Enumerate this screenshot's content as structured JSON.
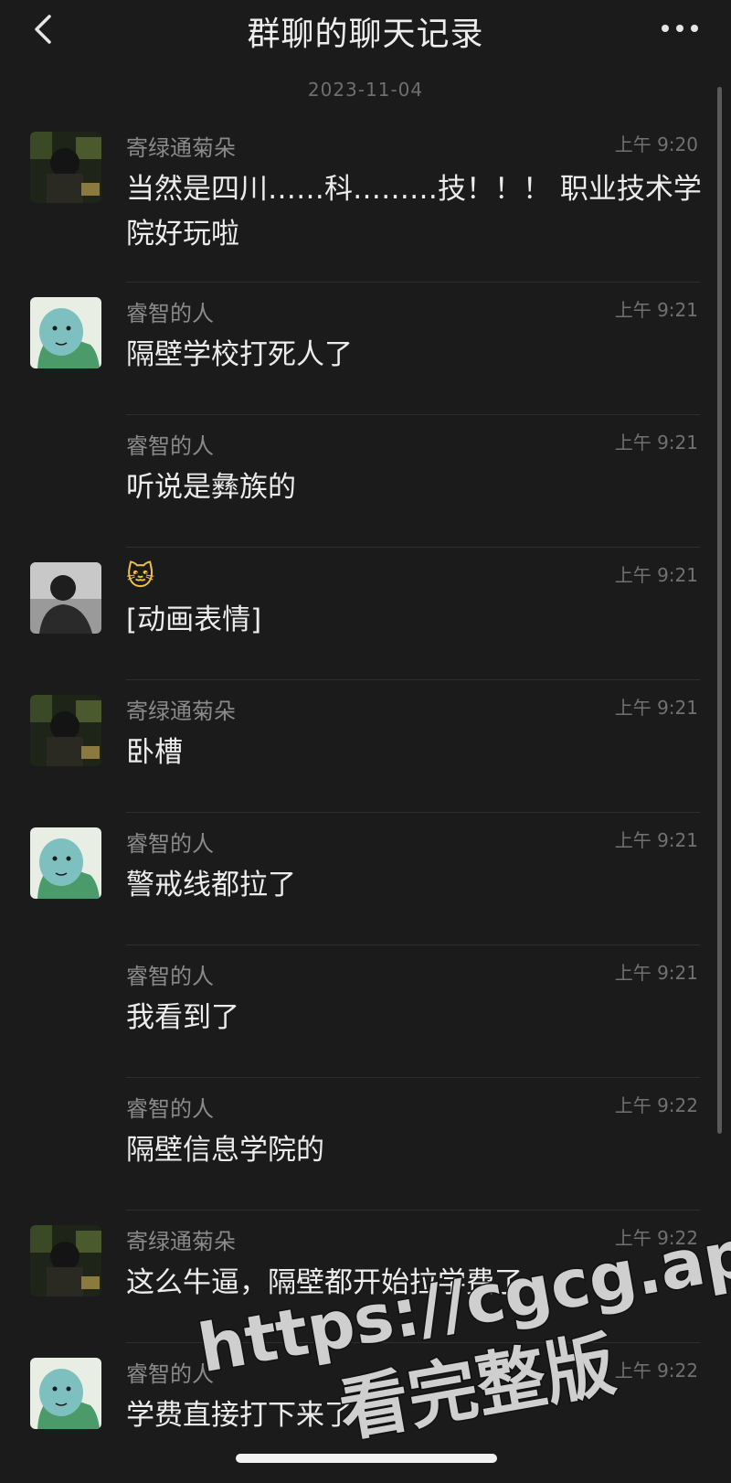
{
  "navbar": {
    "title": "群聊的聊天记录"
  },
  "date_separator": "2023-11-04",
  "messages": [
    {
      "sender": "寄绿通菊朵",
      "time": "上午 9:20",
      "text": "当然是四川……科………技！！！ 职业技术学院好玩啦",
      "avatar": "dark-photo"
    },
    {
      "sender": "睿智的人",
      "time": "上午 9:21",
      "text": "隔壁学校打死人了",
      "avatar": "turtle"
    },
    {
      "sender": "睿智的人",
      "time": "上午 9:21",
      "text": "听说是彝族的",
      "avatar": "none"
    },
    {
      "sender": "",
      "time": "上午 9:21",
      "text": "[动画表情]",
      "avatar": "person",
      "name_icon": "cat-emoji"
    },
    {
      "sender": "寄绿通菊朵",
      "time": "上午 9:21",
      "text": "卧槽",
      "avatar": "dark-photo"
    },
    {
      "sender": "睿智的人",
      "time": "上午 9:21",
      "text": "警戒线都拉了",
      "avatar": "turtle"
    },
    {
      "sender": "睿智的人",
      "time": "上午 9:21",
      "text": "我看到了",
      "avatar": "none"
    },
    {
      "sender": "睿智的人",
      "time": "上午 9:22",
      "text": "隔壁信息学院的",
      "avatar": "none"
    },
    {
      "sender": "寄绿通菊朵",
      "time": "上午 9:22",
      "text": "这么牛逼，隔壁都开始拉学费了",
      "avatar": "dark-photo"
    },
    {
      "sender": "睿智的人",
      "time": "上午 9:22",
      "text": "学费直接打下来了",
      "avatar": "turtle"
    }
  ],
  "watermark": {
    "line1": "https://cgcg.app",
    "line2": "看完整版"
  },
  "icons": {
    "back": "chevron-left-icon",
    "more": "more-dots-icon",
    "emoji": "🐱"
  }
}
